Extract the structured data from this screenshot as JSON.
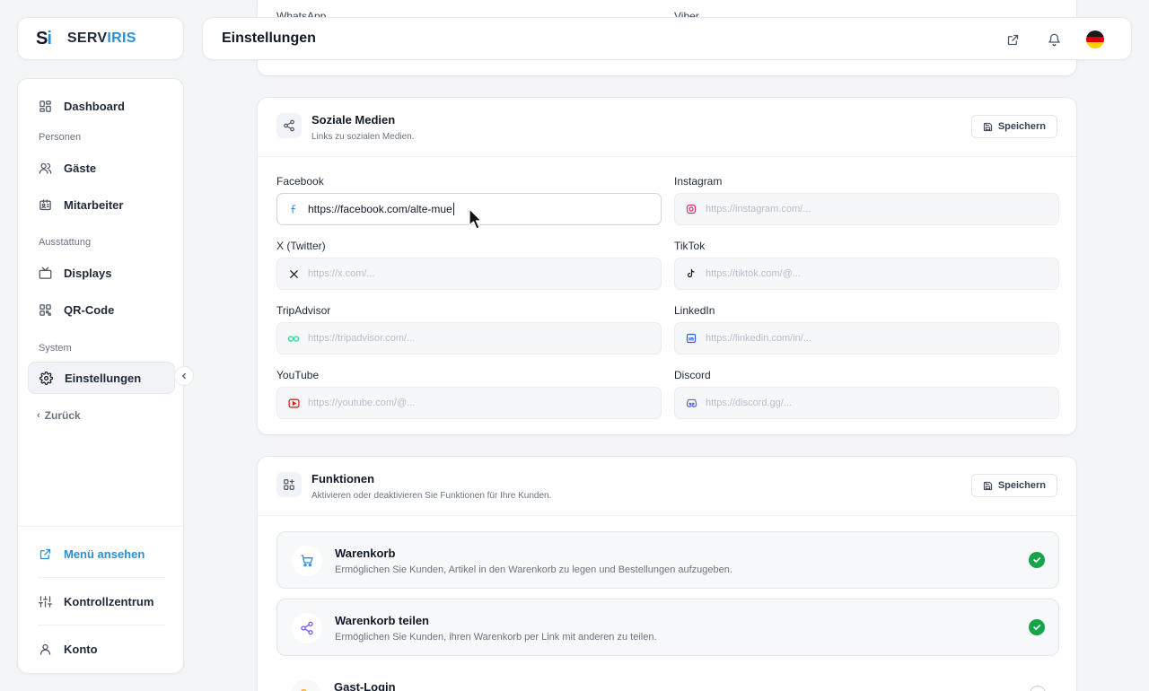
{
  "brand": {
    "mark_a": "S",
    "mark_b": "i",
    "name_a": "SERV",
    "name_b": "IRIS"
  },
  "header": {
    "title": "Einstellungen"
  },
  "sidebar": {
    "items": [
      {
        "label": "Dashboard",
        "icon": "dashboard-icon"
      },
      {
        "label": "Gäste",
        "icon": "users-icon"
      },
      {
        "label": "Mitarbeiter",
        "icon": "id-card-icon"
      },
      {
        "label": "Displays",
        "icon": "tv-icon"
      },
      {
        "label": "QR-Code",
        "icon": "qr-code-icon"
      },
      {
        "label": "Einstellungen",
        "icon": "gear-icon",
        "active": true
      }
    ],
    "sections": {
      "people": "Personen",
      "equipment": "Ausstattung",
      "system": "System"
    },
    "back": "Zurück",
    "bottom": {
      "view_menu": "Menü ansehen",
      "control_center": "Kontrollzentrum",
      "account": "Konto"
    }
  },
  "top_card": {
    "whatsapp": "WhatsApp",
    "viber": "Viber"
  },
  "social": {
    "title": "Soziale Medien",
    "subtitle": "Links zu sozialen Medien.",
    "save": "Speichern",
    "fields": {
      "facebook": {
        "label": "Facebook",
        "value": "https://facebook.com/alte-mue",
        "placeholder": ""
      },
      "instagram": {
        "label": "Instagram",
        "placeholder": "https://instagram.com/..."
      },
      "twitter": {
        "label": "X (Twitter)",
        "placeholder": "https://x.com/..."
      },
      "tiktok": {
        "label": "TikTok",
        "placeholder": "https://tiktok.com/@..."
      },
      "tripadvisor": {
        "label": "TripAdvisor",
        "placeholder": "https://tripadvisor.com/..."
      },
      "linkedin": {
        "label": "LinkedIn",
        "placeholder": "https://linkedin.com/in/..."
      },
      "youtube": {
        "label": "YouTube",
        "placeholder": "https://youtube.com/@..."
      },
      "discord": {
        "label": "Discord",
        "placeholder": "https://discord.gg/..."
      }
    }
  },
  "functions": {
    "title": "Funktionen",
    "subtitle": "Aktivieren oder deaktivieren Sie Funktionen für Ihre Kunden.",
    "save": "Speichern",
    "features": [
      {
        "title": "Warenkorb",
        "desc": "Ermöglichen Sie Kunden, Artikel in den Warenkorb zu legen und Bestellungen aufzugeben.",
        "enabled": true,
        "icon": "cart-icon"
      },
      {
        "title": "Warenkorb teilen",
        "desc": "Ermöglichen Sie Kunden, ihren Warenkorb per Link mit anderen zu teilen.",
        "enabled": true,
        "icon": "share-icon"
      },
      {
        "title": "Gast-Login",
        "desc": "",
        "enabled": false,
        "icon": "key-icon"
      }
    ]
  },
  "colors": {
    "accent": "#2b8fd6",
    "success": "#16a34a",
    "youtube": "#e11d24",
    "instagram": "#e1306c",
    "tripadvisor": "#34e0a1"
  }
}
